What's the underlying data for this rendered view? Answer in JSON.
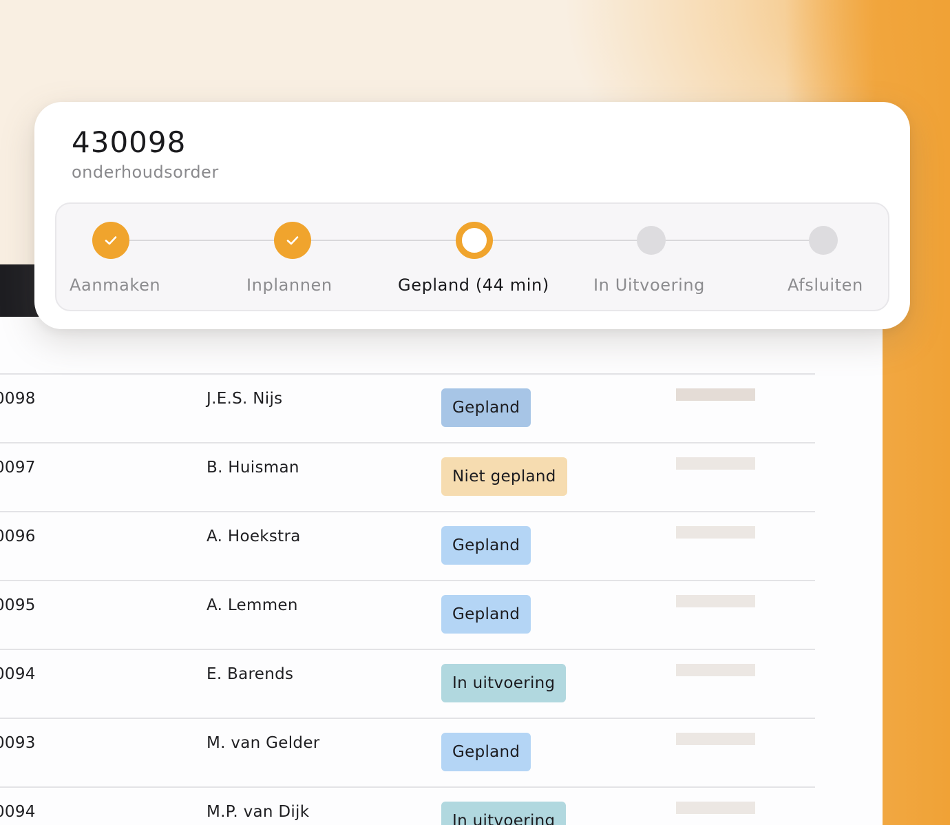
{
  "order": {
    "number": "430098",
    "type": "onderhoudsorder"
  },
  "steps": [
    {
      "label": "Aanmaken",
      "state": "done"
    },
    {
      "label": "Inplannen",
      "state": "done"
    },
    {
      "label": "Gepland (44 min)",
      "state": "current"
    },
    {
      "label": "In Uitvoering",
      "state": "todo"
    },
    {
      "label": "Afsluiten",
      "state": "todo"
    }
  ],
  "rows": [
    {
      "id": "0098",
      "name": "J.E.S. Nijs",
      "status": "Gepland"
    },
    {
      "id": "0097",
      "name": "B. Huisman",
      "status": "Niet gepland"
    },
    {
      "id": "0096",
      "name": "A. Hoekstra",
      "status": "Gepland"
    },
    {
      "id": "0095",
      "name": "A. Lemmen",
      "status": "Gepland"
    },
    {
      "id": "0094",
      "name": "E. Barends",
      "status": "In uitvoering"
    },
    {
      "id": "0093",
      "name": "M. van Gelder",
      "status": "Gepland"
    },
    {
      "id": "0094",
      "name": "M.P. van Dijk",
      "status": "In uitvoering"
    }
  ],
  "colors": {
    "accent": "#f0a42d",
    "badge_gepland": "#b4d5f5",
    "badge_gepland_selected": "#a7c5e6",
    "badge_niet_gepland": "#f6dcb0",
    "badge_in_uitvoering": "#b1d8df"
  }
}
